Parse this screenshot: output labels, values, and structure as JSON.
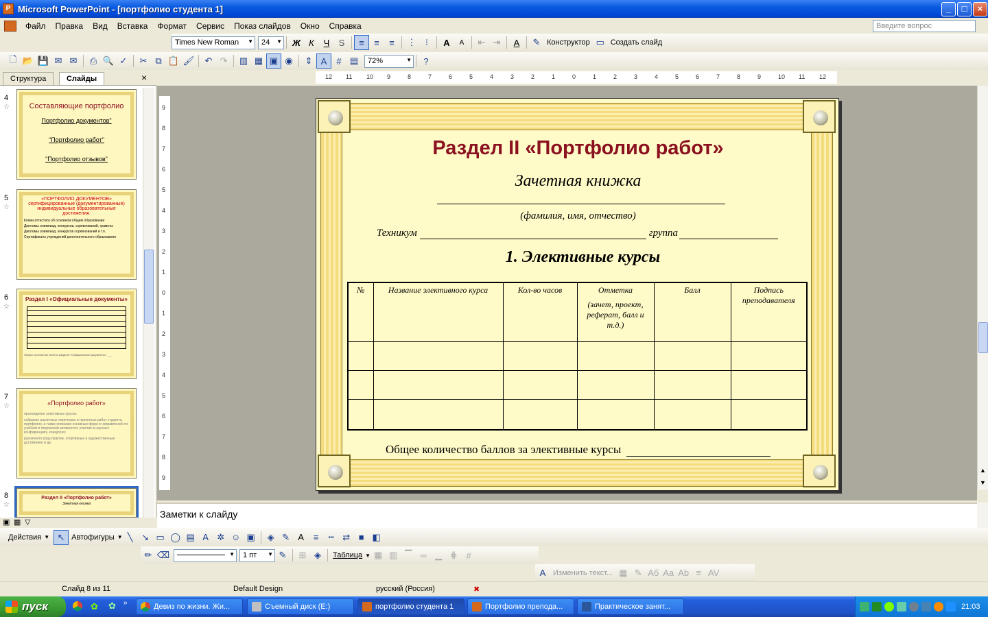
{
  "app": {
    "title": "Microsoft PowerPoint - [портфолио студента 1]",
    "icon": "powerpoint-icon"
  },
  "window_controls": {
    "minimize": "_",
    "maximize": "□",
    "close": "×"
  },
  "menu": [
    "Файл",
    "Правка",
    "Вид",
    "Вставка",
    "Формат",
    "Сервис",
    "Показ слайдов",
    "Окно",
    "Справка"
  ],
  "help_box": {
    "placeholder": "Введите вопрос"
  },
  "formatting_toolbar": {
    "font": "Times New Roman",
    "size": "24",
    "bold": "Ж",
    "italic": "К",
    "underline": "Ч",
    "shadow": "S",
    "designer": "Конструктор",
    "new_slide": "Создать слайд"
  },
  "standard_toolbar": {
    "zoom": "72%"
  },
  "panel_tabs": {
    "outline": "Структура",
    "slides": "Слайды",
    "close": "×"
  },
  "thumbnails": [
    {
      "num": "4",
      "title": "Составляющие портфолио",
      "lines": [
        "Портфолио документов\"",
        "\"Портфолио работ\"",
        "\"Портфолио отзывов\""
      ]
    },
    {
      "num": "5",
      "title": "«ПОРТФОЛИО ДОКУМЕНТОВ» сертифицированные (документированные) индивидуальные образовательные достижения.",
      "lines": [
        "Копии аттестата об основном общем образовании",
        "Дипломы олимпиад, конкурсов, соревнований, грамоты",
        "Дипломы олимпиад, конкурсов соревнований и т.п.",
        "Сертификаты учреждений дополнительного образования"
      ]
    },
    {
      "num": "6",
      "title": "Раздел I «Официальные документы»",
      "lines": [
        "Общее количество баллов раздела «Официальные документы» ___"
      ]
    },
    {
      "num": "7",
      "title": "«Портфолио работ»",
      "lines": [
        "прохождение элективных курсов.",
        "собрание различных творческих и проектных работ студента, портфолио, а также описание основных форм и направлений его учебной и творческой активности: участие в научных конференциях, конкурсах;",
        "различного рода практик, спортивные и художественные достижения и др."
      ]
    },
    {
      "num": "8",
      "title": "Раздел II «Портфолио работ»",
      "lines": [
        "Зачетная книжка"
      ]
    }
  ],
  "ruler": {
    "h_labels": [
      "12",
      "11",
      "10",
      "9",
      "8",
      "7",
      "6",
      "5",
      "4",
      "3",
      "2",
      "1",
      "0",
      "1",
      "2",
      "3",
      "4",
      "5",
      "6",
      "7",
      "8",
      "9",
      "10",
      "11",
      "12"
    ],
    "v_labels": [
      "9",
      "8",
      "7",
      "6",
      "5",
      "4",
      "3",
      "2",
      "1",
      "0",
      "1",
      "2",
      "3",
      "4",
      "5",
      "6",
      "7",
      "8",
      "9"
    ]
  },
  "slide": {
    "title": "Раздел II «Портфолио работ»",
    "subtitle": "Зачетная книжка",
    "name_caption": "(фамилия, имя, отчество)",
    "tech_label": "Техникум",
    "group_label": "группа",
    "section_title": "1. Элективные курсы",
    "table": {
      "headers": [
        "№",
        "Название элективного курса",
        "Кол-во часов",
        "Отметка",
        "Балл",
        "Подпись преподавателя"
      ],
      "mark_note": "(зачет, проект, реферат, балл и т.д.)",
      "empty_rows": 3
    },
    "total_label": "Общее количество баллов за элективные курсы"
  },
  "notes": {
    "placeholder": "Заметки к слайду"
  },
  "drawing_toolbar": {
    "actions": "Действия",
    "autoshapes": "Автофигуры",
    "line_weight": "1 пт",
    "table": "Таблица",
    "edit_text": "Изменить текст..."
  },
  "status": {
    "slide": "Слайд 8 из 11",
    "design": "Default Design",
    "language": "русский (Россия)"
  },
  "taskbar": {
    "start": "пуск",
    "tasks": [
      "Девиз по жизни. Жи...",
      "Съемный диск (E:)",
      "портфолио студента 1",
      "Портфолио препода...",
      "Практическое занят..."
    ],
    "clock": "21:03"
  },
  "colors": {
    "title_red": "#8b1020",
    "slide_bg": "#fffbc8",
    "xp_blue": "#245edb"
  }
}
